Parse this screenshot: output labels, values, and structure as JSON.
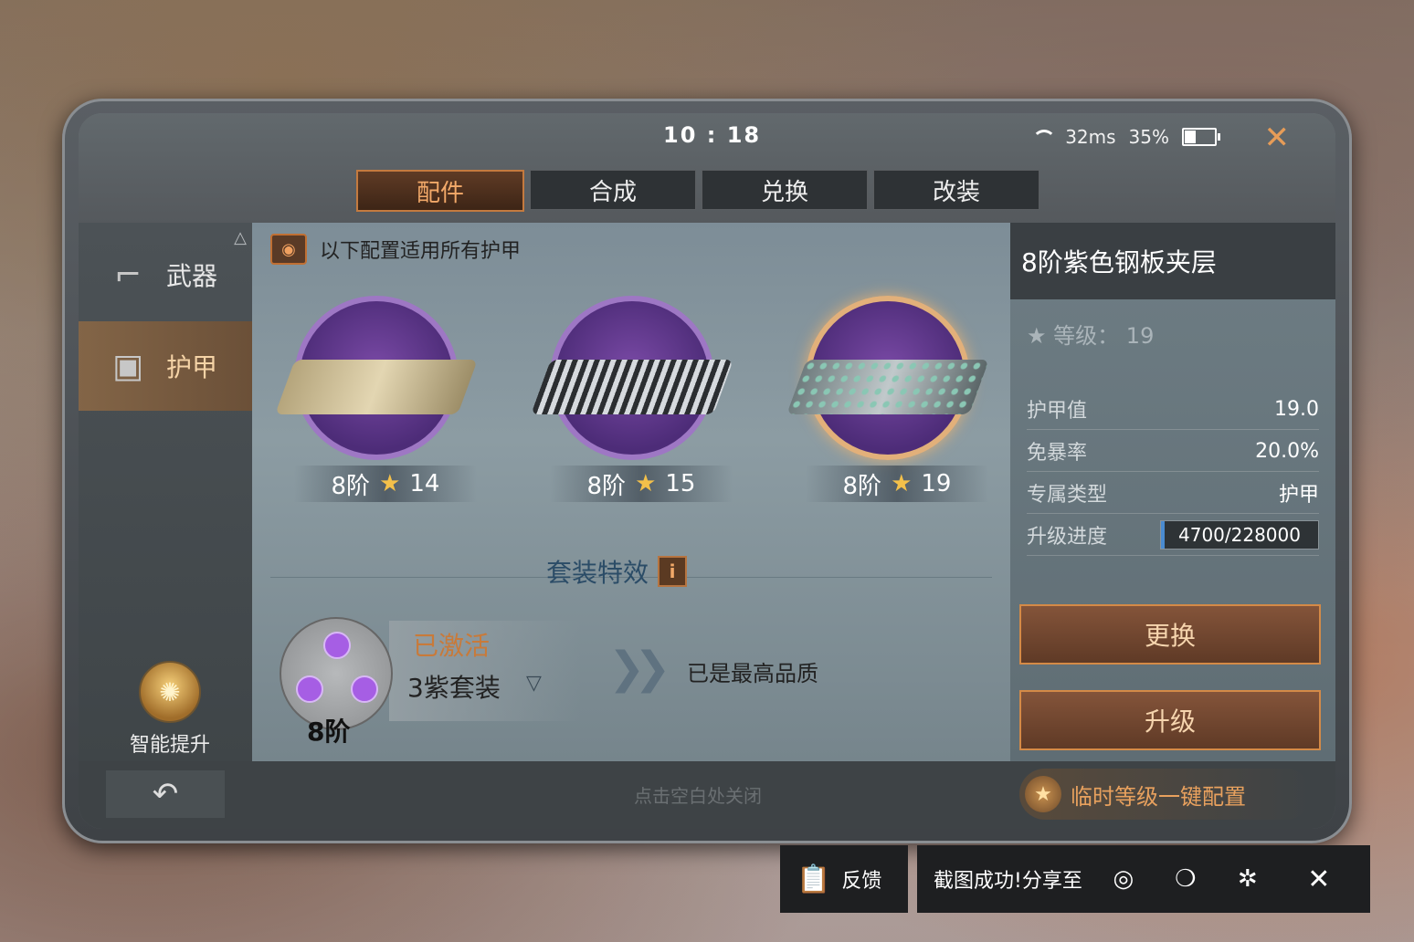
{
  "status": {
    "time": "10 : 18",
    "ping": "32ms",
    "battery": "35%",
    "battery_level": 0.35
  },
  "tabs": [
    {
      "label": "配件",
      "active": true
    },
    {
      "label": "合成"
    },
    {
      "label": "兑换"
    },
    {
      "label": "改装"
    }
  ],
  "sidebar": {
    "items": [
      {
        "label": "武器",
        "icon": "pistol-icon"
      },
      {
        "label": "护甲",
        "icon": "armor-vest-icon",
        "active": true
      }
    ],
    "smart_label": "智能提升"
  },
  "main": {
    "note": "以下配置适用所有护甲",
    "items": [
      {
        "tier": "8阶",
        "stars": "14",
        "color": "#d6c7a0"
      },
      {
        "tier": "8阶",
        "stars": "15",
        "color": "#c2c7cc"
      },
      {
        "tier": "8阶",
        "stars": "19",
        "color": "#9aa7a8",
        "selected": true
      }
    ],
    "suite_title": "套装特效",
    "suite": {
      "status": "已激活",
      "name": "3紫套装",
      "level": "8阶",
      "max_quality": "已是最高品质"
    }
  },
  "detail": {
    "title": "8阶紫色钢板夹层",
    "level_label": "等级：",
    "level_value": "19",
    "stats": [
      {
        "key": "护甲值",
        "value": "19.0"
      },
      {
        "key": "免暴率",
        "value": "20.0%"
      },
      {
        "key": "专属类型",
        "value": "护甲"
      }
    ],
    "progress_label": "升级进度",
    "progress_text": "4700/228000",
    "progress_fraction": 0.0206,
    "btn_replace": "更换",
    "btn_upgrade": "升级"
  },
  "bottom": {
    "hint": "点击空白处关闭",
    "onekey": "临时等级一键配置"
  },
  "share": {
    "feedback": "反馈",
    "text": "截图成功!分享至"
  },
  "colors": {
    "accent": "#e69c58",
    "purple": "#a65ee4",
    "button_border": "#d48a47"
  }
}
